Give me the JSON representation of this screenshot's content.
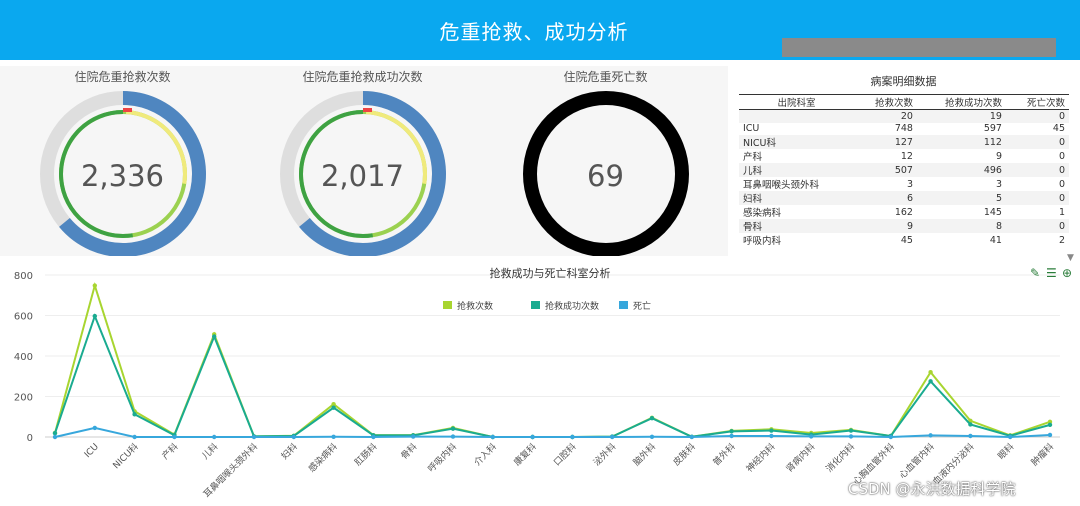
{
  "header": {
    "title": "危重抢救、成功分析"
  },
  "gauges": [
    {
      "title": "住院危重抢救次数",
      "value": "2,336",
      "ring": "blue"
    },
    {
      "title": "住院危重抢救成功次数",
      "value": "2,017",
      "ring": "blue"
    },
    {
      "title": "住院危重死亡数",
      "value": "69",
      "ring": "black"
    }
  ],
  "table": {
    "title": "病案明细数据",
    "columns": [
      "出院科室",
      "抢救次数",
      "抢救成功次数",
      "死亡次数"
    ],
    "rows": [
      [
        "",
        "20",
        "19",
        "0"
      ],
      [
        "ICU",
        "748",
        "597",
        "45"
      ],
      [
        "NICU科",
        "127",
        "112",
        "0"
      ],
      [
        "产科",
        "12",
        "9",
        "0"
      ],
      [
        "儿科",
        "507",
        "496",
        "0"
      ],
      [
        "耳鼻咽喉头颈外科",
        "3",
        "3",
        "0"
      ],
      [
        "妇科",
        "6",
        "5",
        "0"
      ],
      [
        "感染病科",
        "162",
        "145",
        "1"
      ],
      [
        "骨科",
        "9",
        "8",
        "0"
      ],
      [
        "呼吸内科",
        "45",
        "41",
        "2"
      ]
    ]
  },
  "colors": {
    "rescue": "#a8d530",
    "success": "#1aab90",
    "death": "#37a7dc",
    "header": "#0aa8ef"
  },
  "icons": [
    "pencil-icon",
    "list-icon",
    "zoom-in-icon"
  ],
  "watermark": "CSDN @永洪数据科学院",
  "chart_data": {
    "type": "line",
    "title": "抢救成功与死亡科室分析",
    "xlabel": "",
    "ylabel": "",
    "ylim": [
      0,
      800
    ],
    "yticks": [
      0,
      200,
      400,
      600,
      800
    ],
    "grid": true,
    "legend": "top-center",
    "categories": [
      "",
      "ICU",
      "NICU科",
      "产科",
      "儿科",
      "耳鼻咽喉头颈外科",
      "妇科",
      "感染病科",
      "肛肠科",
      "骨科",
      "呼吸内科",
      "介入科",
      "康复科",
      "口腔科",
      "泌外科",
      "脑外科",
      "皮肤科",
      "普外科",
      "神经内科",
      "肾病内科",
      "消化内科",
      "心胸血管外科",
      "心血管内科",
      "血液内分泌科",
      "眼科",
      "肿瘤科"
    ],
    "series": [
      {
        "name": "抢救次数",
        "color": "#a8d530",
        "values": [
          20,
          748,
          127,
          12,
          507,
          3,
          6,
          162,
          9,
          9,
          45,
          0,
          0,
          0,
          2,
          95,
          1,
          30,
          38,
          20,
          35,
          5,
          320,
          80,
          8,
          75
        ]
      },
      {
        "name": "抢救成功次数",
        "color": "#1aab90",
        "values": [
          19,
          597,
          112,
          9,
          496,
          3,
          5,
          145,
          8,
          8,
          41,
          0,
          0,
          0,
          2,
          93,
          1,
          28,
          32,
          12,
          32,
          5,
          275,
          62,
          6,
          60
        ]
      },
      {
        "name": "死亡",
        "color": "#37a7dc",
        "values": [
          0,
          45,
          0,
          0,
          0,
          0,
          0,
          1,
          0,
          2,
          2,
          0,
          0,
          0,
          0,
          1,
          0,
          5,
          5,
          3,
          3,
          0,
          8,
          5,
          0,
          10
        ]
      }
    ]
  }
}
